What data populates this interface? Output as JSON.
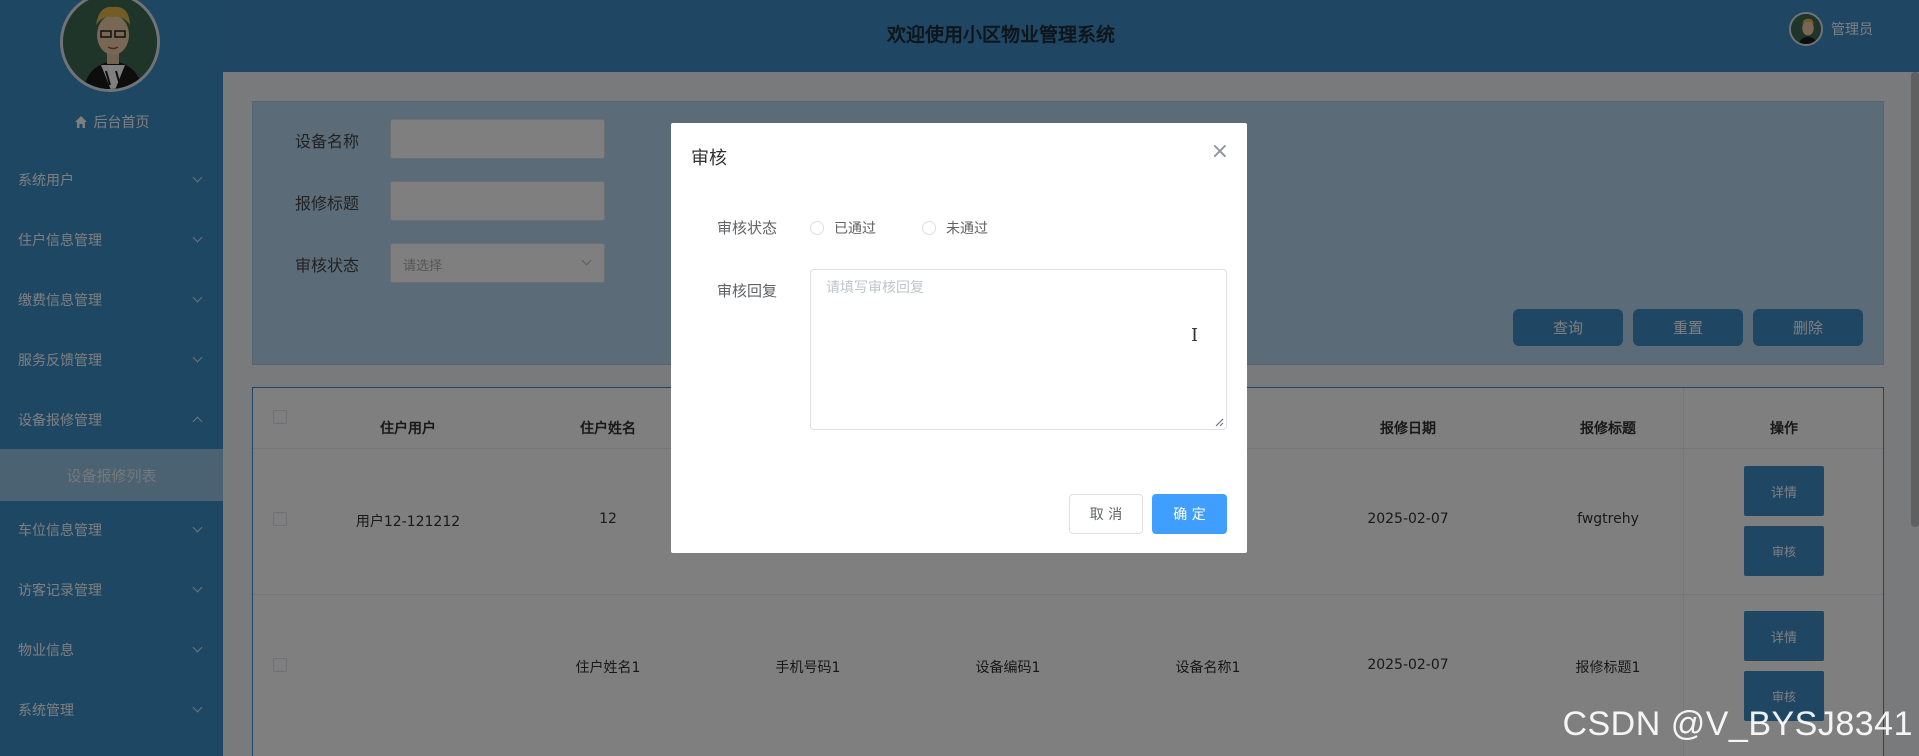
{
  "header": {
    "title": "欢迎使用小区物业管理系统",
    "user_name": "管理员"
  },
  "sidebar": {
    "home_label": "后台首页",
    "items": [
      {
        "label": "系统用户",
        "expanded": false
      },
      {
        "label": "住户信息管理",
        "expanded": false
      },
      {
        "label": "缴费信息管理",
        "expanded": false
      },
      {
        "label": "服务反馈管理",
        "expanded": false
      },
      {
        "label": "设备报修管理",
        "expanded": true
      },
      {
        "label": "车位信息管理",
        "expanded": false
      },
      {
        "label": "访客记录管理",
        "expanded": false
      },
      {
        "label": "物业信息",
        "expanded": false
      },
      {
        "label": "系统管理",
        "expanded": false
      }
    ],
    "active_subitem": "设备报修列表"
  },
  "search": {
    "device_name_label": "设备名称",
    "repair_title_label": "报修标题",
    "audit_status_label": "审核状态",
    "audit_status_placeholder": "请选择",
    "query_button": "查询",
    "reset_button": "重置",
    "delete_button": "删除"
  },
  "table": {
    "columns": [
      "住户用户",
      "住户姓名",
      "报修日期",
      "报修标题",
      "操作"
    ],
    "rows": [
      {
        "user": "用户12-121212",
        "name": "12",
        "phone": "",
        "device_code": "",
        "device_name": "",
        "date": "2025-02-07",
        "title": "fwgtrehy"
      },
      {
        "user": "",
        "name": "住户姓名1",
        "phone": "手机号码1",
        "device_code": "设备编码1",
        "device_name": "设备名称1",
        "date": "2025-02-07",
        "title": "报修标题1"
      }
    ],
    "detail_button": "详情",
    "audit_button": "审核"
  },
  "dialog": {
    "title": "审核",
    "status_label": "审核状态",
    "option_passed": "已通过",
    "option_rejected": "未通过",
    "reply_label": "审核回复",
    "reply_placeholder": "请填写审核回复",
    "cancel_button": "取 消",
    "confirm_button": "确 定",
    "confirm_color": "#409eff"
  },
  "watermark": "CSDN @V_BYSJ8341",
  "colors": {
    "primary": "#3e8ec8",
    "sidebar": "#3d8ec8",
    "accent": "#409eff"
  }
}
